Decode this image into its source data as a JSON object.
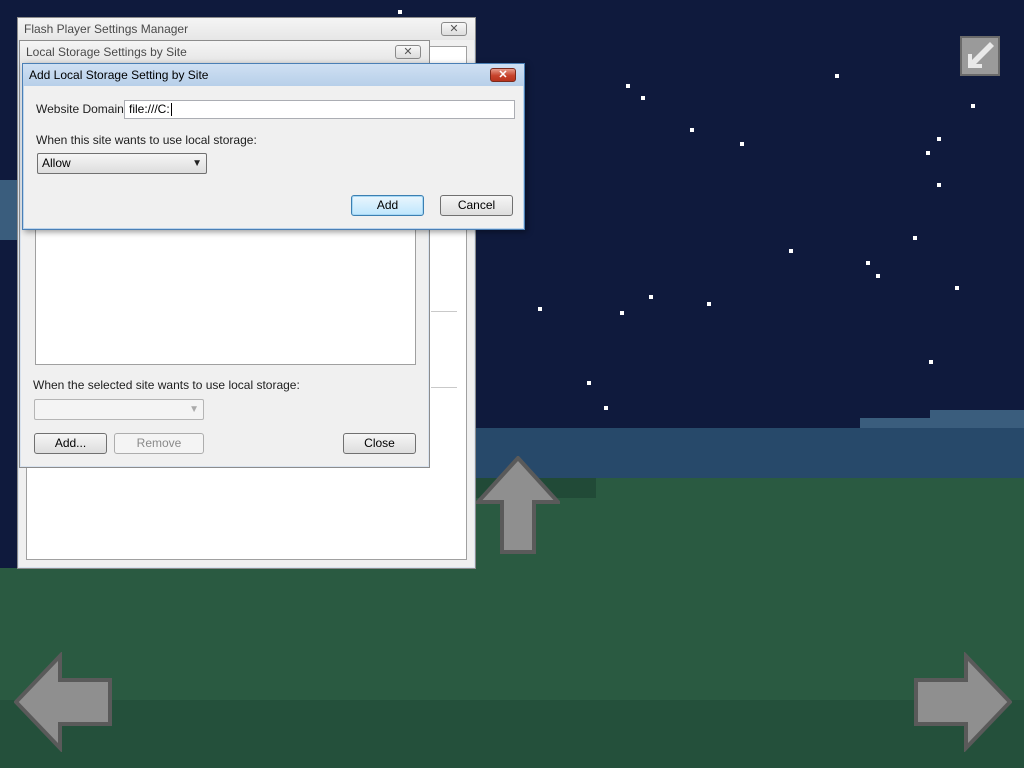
{
  "windows": {
    "settings_manager": {
      "title": "Flash Player Settings Manager",
      "close_label": "✕"
    },
    "local_storage": {
      "title": "Local Storage Settings by Site",
      "close_label": "✕",
      "selected_site_label": "When the selected site wants to use local storage:",
      "selected_site_value": "",
      "add_label": "Add...",
      "remove_label": "Remove",
      "close_button_label": "Close"
    },
    "add_setting": {
      "title": "Add Local Storage Setting by Site",
      "close_label": "✕",
      "domain_label": "Website Domain:",
      "domain_value": "file:///C:",
      "storage_label": "When this site wants to use local storage:",
      "storage_value": "Allow",
      "add_label": "Add",
      "cancel_label": "Cancel"
    }
  },
  "game": {
    "controls": [
      "fullscreen-toggle",
      "up-arrow",
      "left-arrow",
      "right-arrow"
    ]
  },
  "colors": {
    "sky": "#0f1a3d",
    "grass": "#2a5a41",
    "mountain": "#3a5d7d",
    "arrow": "#8f8f8f"
  }
}
